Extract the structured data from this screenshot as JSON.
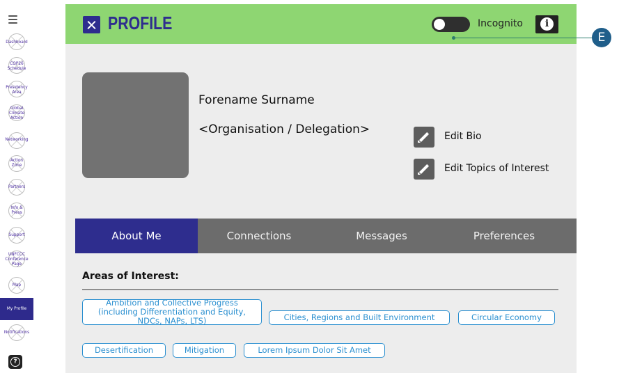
{
  "sidebar": {
    "items": [
      {
        "label": "Dashboard"
      },
      {
        "label": "COP26 Schedule"
      },
      {
        "label": "Presidency Area"
      },
      {
        "label": "Global Climate Action"
      },
      {
        "label": "Networking"
      },
      {
        "label": "Action Zone"
      },
      {
        "label": "Partners"
      },
      {
        "label": "Info & Press"
      },
      {
        "label": "Support"
      },
      {
        "label": "UNFCCC Conference Page"
      },
      {
        "label": "Map"
      },
      {
        "label": "My Profile"
      },
      {
        "label": "Notifications"
      }
    ],
    "help_icon": "question-icon"
  },
  "header": {
    "title": "PROFILE",
    "incognito_label": "Incognito",
    "toggle_on": false,
    "info_icon": "info-icon"
  },
  "marker": {
    "label": "E"
  },
  "profile": {
    "name": "Forename Surname",
    "organisation": "<Organisation / Delegation>",
    "edit_bio": "Edit Bio",
    "edit_topics": "Edit Topics of Interest"
  },
  "tabs": [
    {
      "label": "About Me",
      "active": true
    },
    {
      "label": "Connections",
      "active": false
    },
    {
      "label": "Messages",
      "active": false
    },
    {
      "label": "Preferences",
      "active": false
    }
  ],
  "interests": {
    "title": "Areas of Interest:",
    "chips": [
      "Ambition and Collective Progress (including Differentiation and Equity, NDCs, NAPs, LTS)",
      "Cities, Regions and Built Environment",
      "Circular Economy",
      "Desertification",
      "Mitigation",
      "Lorem Ipsum Dolor Sit Amet"
    ]
  },
  "colors": {
    "header_bg": "#8ed672",
    "brand_navy": "#2e2d8e",
    "chip_blue": "#2a8fd0",
    "tab_bar": "#6c6c6c"
  }
}
